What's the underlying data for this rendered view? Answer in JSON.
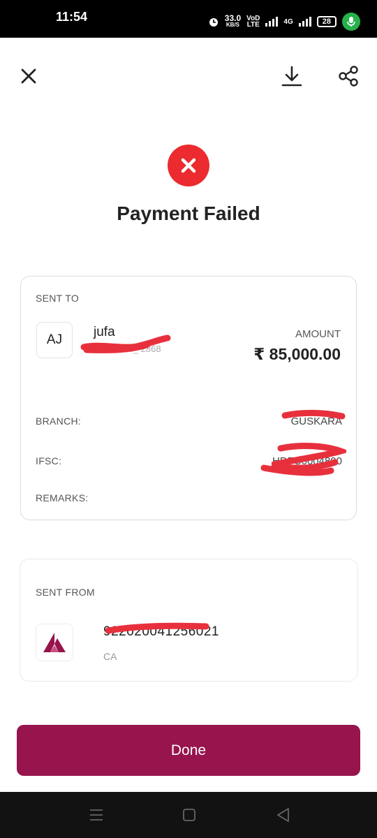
{
  "status_bar": {
    "time": "11:54",
    "speed_value": "33.0",
    "speed_unit": "KB/S",
    "volte_top": "VoD",
    "volte_bottom": "LTE",
    "net_top": "4G",
    "battery": "28"
  },
  "header": {
    "close_icon": "close-icon",
    "download_icon": "download-icon",
    "share_icon": "share-icon"
  },
  "status": {
    "title": "Payment Failed",
    "icon": "error-x-icon",
    "color": "#eb2b2f"
  },
  "sent_to": {
    "section_label": "SENT TO",
    "avatar_initials": "AJ",
    "name": "jufa",
    "account_partial": "X00000_ 2868",
    "amount_label": "AMOUNT",
    "amount": "₹ 85,000.00",
    "branch_label": "BRANCH:",
    "branch_value": "GUSKARA",
    "ifsc_label": "IFSC:",
    "ifsc_value": "HDFC0004800",
    "remarks_label": "REMARKS:"
  },
  "sent_from": {
    "section_label": "SENT FROM",
    "account_number": "922020041256021",
    "account_type": "CA",
    "bank_logo": "axis-bank-logo"
  },
  "actions": {
    "done_label": "Done",
    "done_color": "#97144d"
  },
  "nav_bar": {
    "menu_icon": "menu-icon",
    "home_icon": "home-square-icon",
    "back_icon": "back-triangle-icon"
  }
}
